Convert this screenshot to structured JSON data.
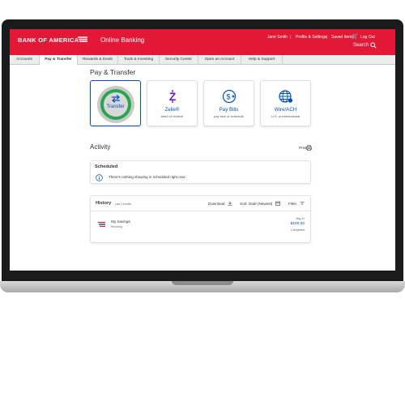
{
  "brand": {
    "name": "BANK OF AMERICA",
    "product": "Online Banking",
    "color_primary": "#e31837",
    "color_link": "#0052c2"
  },
  "header": {
    "user_name": "Jane Smith",
    "profile_settings": "Profile & Settings",
    "saved_items": "Saved Items",
    "logout": "Log Out",
    "search": "Search",
    "separator": "|"
  },
  "nav": {
    "tabs": [
      {
        "label": "Accounts"
      },
      {
        "label": "Pay & Transfer"
      },
      {
        "label": "Rewards & Deals"
      },
      {
        "label": "Tools & Investing"
      },
      {
        "label": "Security Center"
      },
      {
        "label": "Open an Account"
      },
      {
        "label": "Help & Support"
      }
    ],
    "active_index": 1
  },
  "main": {
    "title": "Pay & Transfer",
    "tiles": [
      {
        "title": "Transfer",
        "subtitle": "",
        "icon": "transfer-arrows-icon"
      },
      {
        "title": "Zelle®",
        "subtitle": "send or receive",
        "icon": "zelle-icon"
      },
      {
        "title": "Pay Bills",
        "subtitle": "pay now or schedule",
        "icon": "pay-bills-icon"
      },
      {
        "title": "Wire/ACH",
        "subtitle": "U.S. or international",
        "icon": "globe-icon"
      }
    ]
  },
  "activity": {
    "title": "Activity",
    "print_label": "Print",
    "scheduled": {
      "title": "Scheduled",
      "message": "There's nothing showing in scheduled right now"
    },
    "history": {
      "title": "History",
      "range": "Last 3 months",
      "download": "Download",
      "sort": "Sort: Date (Newest)",
      "filter": "Filter",
      "transactions": [
        {
          "name": "My Savings",
          "type": "Recurring",
          "date": "May 31",
          "amount": "$100.00",
          "status": "Completed"
        }
      ]
    }
  }
}
